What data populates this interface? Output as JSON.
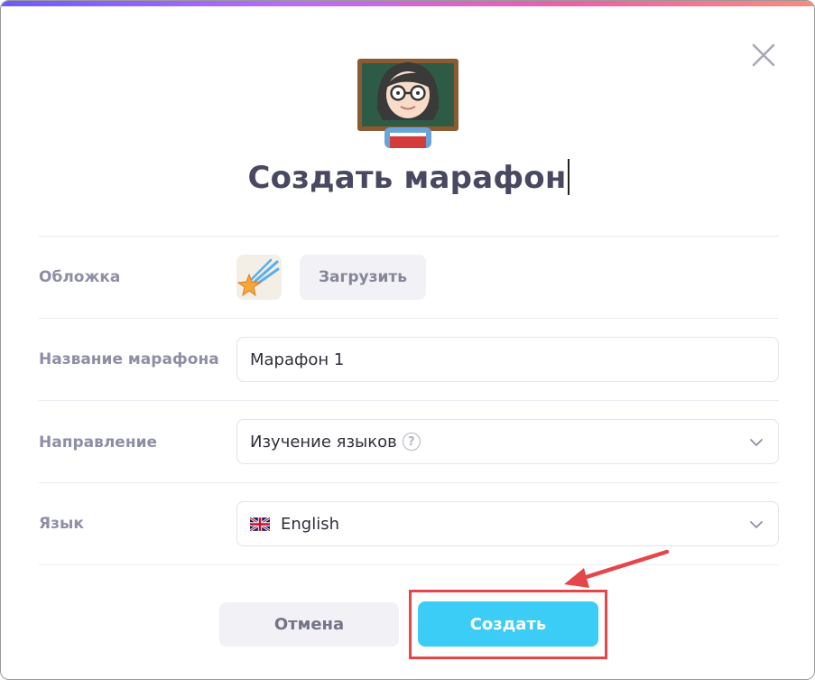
{
  "dialog": {
    "title": "Создать марафон",
    "close_icon": "close-icon",
    "hero_icon": "teacher-emoji-icon"
  },
  "form": {
    "cover": {
      "label": "Обложка",
      "thumb_icon": "shooting-star-icon",
      "upload_label": "Загрузить"
    },
    "name": {
      "label": "Название марафона",
      "value": "Марафон 1"
    },
    "direction": {
      "label": "Направление",
      "value": "Изучение языков",
      "help_icon": "?"
    },
    "language": {
      "label": "Язык",
      "value": "English",
      "flag_icon": "uk-flag-icon"
    }
  },
  "actions": {
    "cancel_label": "Отмена",
    "create_label": "Создать"
  },
  "colors": {
    "accent": "#3ccdf7",
    "annotation": "#e5464a",
    "title_text": "#484861",
    "label_text": "#8e8ea6"
  }
}
